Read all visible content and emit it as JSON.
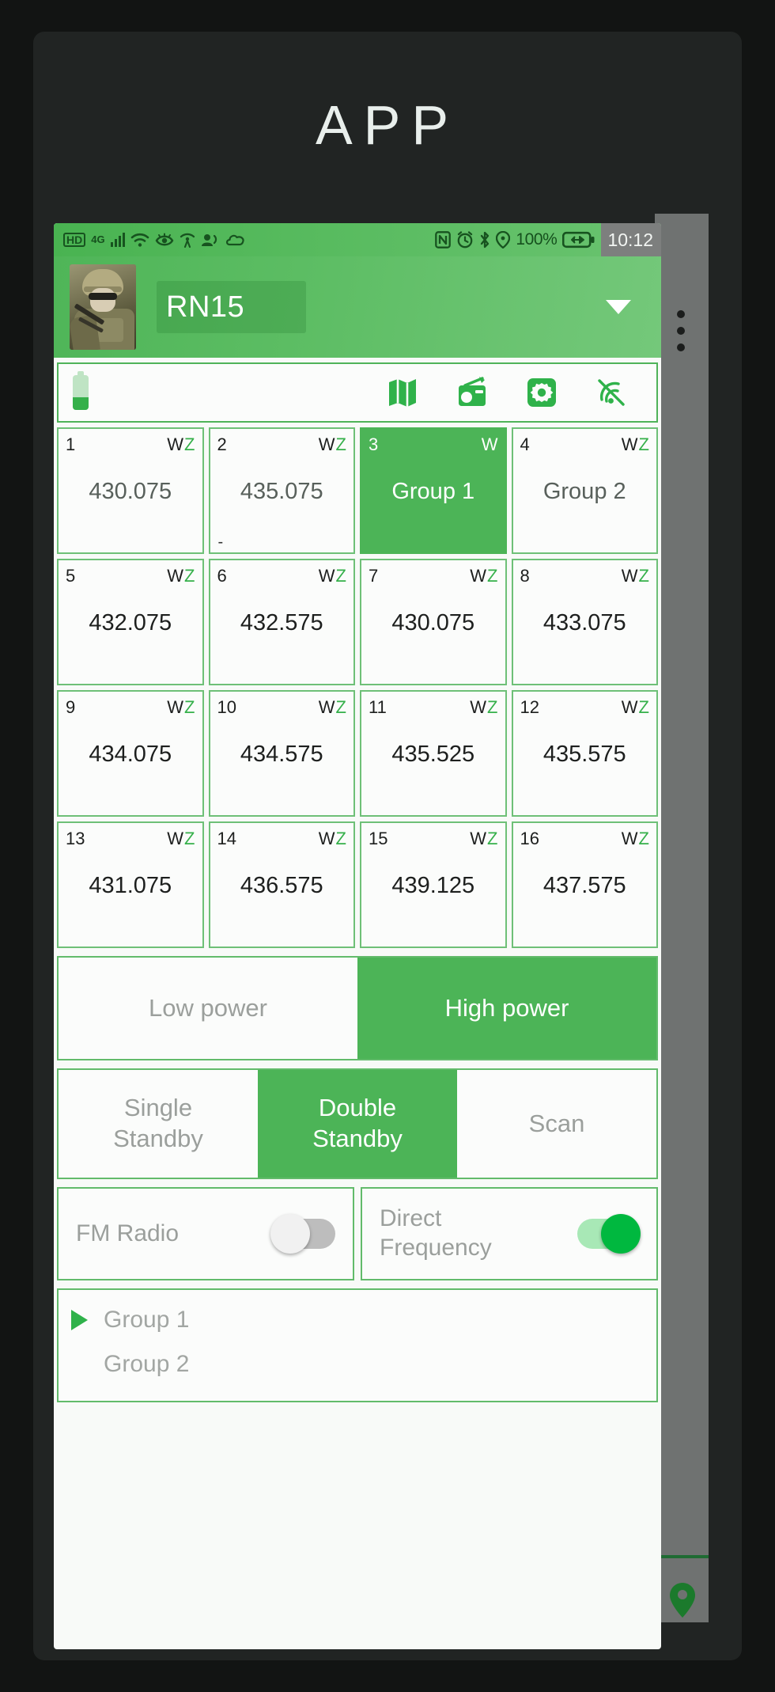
{
  "window": {
    "title": "APP"
  },
  "statusbar": {
    "left_icons": [
      "hd-icon",
      "4g-signal-icon",
      "wifi-icon",
      "eye-icon",
      "hotspot-icon",
      "contacts-sync-icon",
      "cloud-icon"
    ],
    "hd_label": "HD",
    "net_label": "4G",
    "right_icons": [
      "nfc-icon",
      "alarm-clock-icon",
      "bluetooth-icon",
      "location-icon",
      "battery-charging-icon"
    ],
    "battery_percent": "100%",
    "time": "10:12"
  },
  "header": {
    "avatar": "soldier-avatar",
    "device_name": "RN15",
    "dropdown_icon": "chevron-down-icon",
    "overflow_icon": "kebab-menu-icon",
    "fab_icon": "location-pin-icon"
  },
  "toolbar": {
    "battery_icon": "battery-vertical-icon",
    "items": [
      {
        "icon": "map-icon",
        "name": "map-button"
      },
      {
        "icon": "radio-icon",
        "name": "radio-button"
      },
      {
        "icon": "gear-icon",
        "name": "settings-button"
      },
      {
        "icon": "signal-off-icon",
        "name": "mute-signal-button"
      }
    ]
  },
  "channels": {
    "tag_w": "W",
    "tag_z": "Z",
    "cells": [
      {
        "no": "1",
        "value": "430.075",
        "tags": "WZ",
        "selected": false,
        "dim": true,
        "dash": false
      },
      {
        "no": "2",
        "value": "435.075",
        "tags": "WZ",
        "selected": false,
        "dim": true,
        "dash": true,
        "dash_text": "-"
      },
      {
        "no": "3",
        "value": "Group 1",
        "tags": "W",
        "selected": true,
        "dim": false,
        "dash": false
      },
      {
        "no": "4",
        "value": "Group 2",
        "tags": "WZ",
        "selected": false,
        "dim": true,
        "dash": false
      },
      {
        "no": "5",
        "value": "432.075",
        "tags": "WZ",
        "selected": false,
        "dim": false,
        "dash": false
      },
      {
        "no": "6",
        "value": "432.575",
        "tags": "WZ",
        "selected": false,
        "dim": false,
        "dash": false
      },
      {
        "no": "7",
        "value": "430.075",
        "tags": "WZ",
        "selected": false,
        "dim": false,
        "dash": false
      },
      {
        "no": "8",
        "value": "433.075",
        "tags": "WZ",
        "selected": false,
        "dim": false,
        "dash": false
      },
      {
        "no": "9",
        "value": "434.075",
        "tags": "WZ",
        "selected": false,
        "dim": false,
        "dash": false
      },
      {
        "no": "10",
        "value": "434.575",
        "tags": "WZ",
        "selected": false,
        "dim": false,
        "dash": false
      },
      {
        "no": "11",
        "value": "435.525",
        "tags": "WZ",
        "selected": false,
        "dim": false,
        "dash": false
      },
      {
        "no": "12",
        "value": "435.575",
        "tags": "WZ",
        "selected": false,
        "dim": false,
        "dash": false
      },
      {
        "no": "13",
        "value": "431.075",
        "tags": "WZ",
        "selected": false,
        "dim": false,
        "dash": false
      },
      {
        "no": "14",
        "value": "436.575",
        "tags": "WZ",
        "selected": false,
        "dim": false,
        "dash": false
      },
      {
        "no": "15",
        "value": "439.125",
        "tags": "WZ",
        "selected": false,
        "dim": false,
        "dash": false
      },
      {
        "no": "16",
        "value": "437.575",
        "tags": "WZ",
        "selected": false,
        "dim": false,
        "dash": false
      }
    ]
  },
  "power": {
    "low_label": "Low power",
    "high_label": "High power",
    "selected": "High power"
  },
  "standby": {
    "single_label": "Single\nStandby",
    "single_line1": "Single",
    "single_line2": "Standby",
    "double_line1": "Double",
    "double_line2": "Standby",
    "scan_label": "Scan",
    "selected": "Double Standby"
  },
  "toggles": [
    {
      "label": "FM Radio",
      "line1": "FM Radio",
      "line2": "",
      "on": false
    },
    {
      "label": "Direct Frequency",
      "line1": "Direct",
      "line2": "Frequency",
      "on": true
    }
  ],
  "groups": {
    "items": [
      {
        "name": "Group 1",
        "playing": true
      },
      {
        "name": "Group 2",
        "playing": false
      }
    ]
  },
  "colors": {
    "brand_green": "#4cb457",
    "accent_green": "#35b04a",
    "toggle_on": "#00b83f",
    "shell_dark": "#212423",
    "muted_text": "#9b9f9c"
  }
}
